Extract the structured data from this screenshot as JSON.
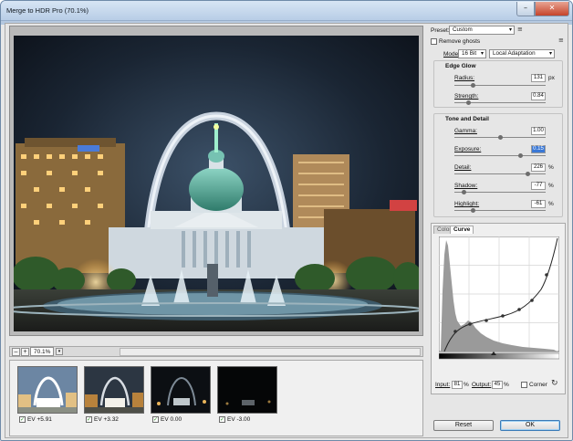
{
  "window": {
    "title": "Merge to HDR Pro (70.1%)",
    "minimize_glyph": "–",
    "close_glyph": "✕"
  },
  "preview": {
    "zoom_value": "70.1%",
    "zoom_out_glyph": "–",
    "zoom_in_glyph": "+",
    "dropdown_glyph": "▾"
  },
  "filmstrip": {
    "items": [
      {
        "label": "EV +5.91",
        "checked": true
      },
      {
        "label": "EV +3.32",
        "checked": true
      },
      {
        "label": "EV 0.00",
        "checked": true
      },
      {
        "label": "EV -3.00",
        "checked": true
      }
    ],
    "check_glyph": "✓"
  },
  "panel": {
    "preset_label": "Preset:",
    "preset_value": "Custom",
    "remove_ghosts_label": "Remove ghosts",
    "mode_label": "Mode:",
    "mode_bit_value": "16 Bit",
    "mode_method_value": "Local Adaptation",
    "menu_glyph": "≡",
    "edge_glow": {
      "title": "Edge Glow",
      "radius": {
        "label": "Radius:",
        "value": "131",
        "unit": "px",
        "level": 0.2
      },
      "strength": {
        "label": "Strength:",
        "value": "0.84",
        "unit": "",
        "level": 0.15
      }
    },
    "tone_detail": {
      "title": "Tone and Detail",
      "gamma": {
        "label": "Gamma:",
        "value": "1.00",
        "unit": "",
        "level": 0.5
      },
      "exposure": {
        "label": "Exposure:",
        "value": "0.15",
        "unit": "",
        "level": 0.72
      },
      "detail": {
        "label": "Detail:",
        "value": "226",
        "unit": "%",
        "level": 0.8
      },
      "shadow": {
        "label": "Shadow:",
        "value": "-77",
        "unit": "%",
        "level": 0.1
      },
      "highlight": {
        "label": "Highlight:",
        "value": "-61",
        "unit": "%",
        "level": 0.2
      }
    },
    "tabs": {
      "color": "Color",
      "curve": "Curve"
    },
    "curve": {
      "input_label": "Input:",
      "input_value": "81",
      "output_label": "Output:",
      "output_value": "45",
      "percent": "%",
      "corner_label": "Corner"
    },
    "reset_label": "Reset",
    "ok_label": "OK"
  }
}
